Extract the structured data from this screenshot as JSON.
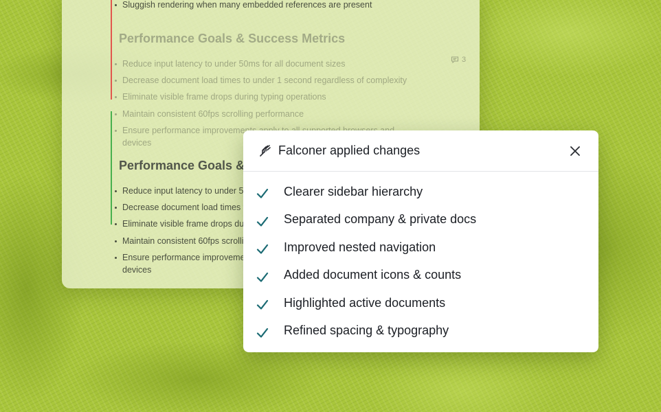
{
  "document": {
    "top_item": "Sluggish rendering when many embedded references are present",
    "sections": [
      {
        "heading": "Performance Goals & Success Metrics",
        "items": [
          "Reduce input latency to under 50ms for all document sizes",
          "Decrease document load times to under 1 second regardless of complexity",
          "Eliminate visible frame drops during typing operations",
          "Maintain consistent 60fps scrolling performance",
          "Ensure performance improvements apply to all supported browsers and devices"
        ]
      },
      {
        "heading": "Performance Goals & Success Metrics",
        "items": [
          "Reduce input latency to under 50ms for all document sizes",
          "Decrease document load times to under 1 second regardless of complexity",
          "Eliminate visible frame drops during typing operations",
          "Maintain consistent 60fps scrolling performance",
          "Ensure performance improvements apply to all supported browsers and devices"
        ]
      }
    ],
    "comment_count": "3",
    "comment_icon": "comment-icon",
    "colors": {
      "removed_bar": "#e2564d",
      "added_bar": "#48b04e"
    }
  },
  "dialog": {
    "title": "Falconer applied changes",
    "logo_icon": "falconer-logo-icon",
    "close_icon": "close-icon",
    "check_color": "#1a6a73",
    "changes": [
      "Clearer sidebar hierarchy",
      "Separated company & private docs",
      "Improved nested navigation",
      "Added document icons & counts",
      "Highlighted active documents",
      "Refined spacing & typography"
    ]
  }
}
